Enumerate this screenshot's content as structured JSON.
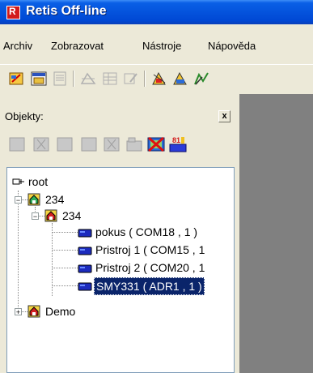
{
  "window": {
    "title": "Retis Off-line"
  },
  "menu": {
    "items": [
      "Archiv",
      "Zobrazovat",
      "Nástroje",
      "Nápověda"
    ]
  },
  "toolbar": {
    "icons": [
      "new-project-icon",
      "open-icon",
      "document-icon",
      "layout-icon",
      "grid-icon",
      "edit-icon",
      "tool1-icon",
      "tool2-icon",
      "chart-icon"
    ]
  },
  "panel": {
    "label": "Objekty:",
    "close_label": "x"
  },
  "tree": {
    "root_label": "root",
    "group_label": "234",
    "subgroup_label": "234",
    "devices": [
      {
        "label": "pokus ( COM18 , 1 )"
      },
      {
        "label": "Pristroj 1 ( COM15 , 1"
      },
      {
        "label": "Pristroj 2 ( COM20 , 1"
      },
      {
        "label": "SMY331 ( ADR1 , 1 )"
      }
    ],
    "demo_label": "Demo"
  },
  "colors": {
    "titlebar": "#0453dc",
    "selection": "#0a246a",
    "workspace": "#808080"
  }
}
